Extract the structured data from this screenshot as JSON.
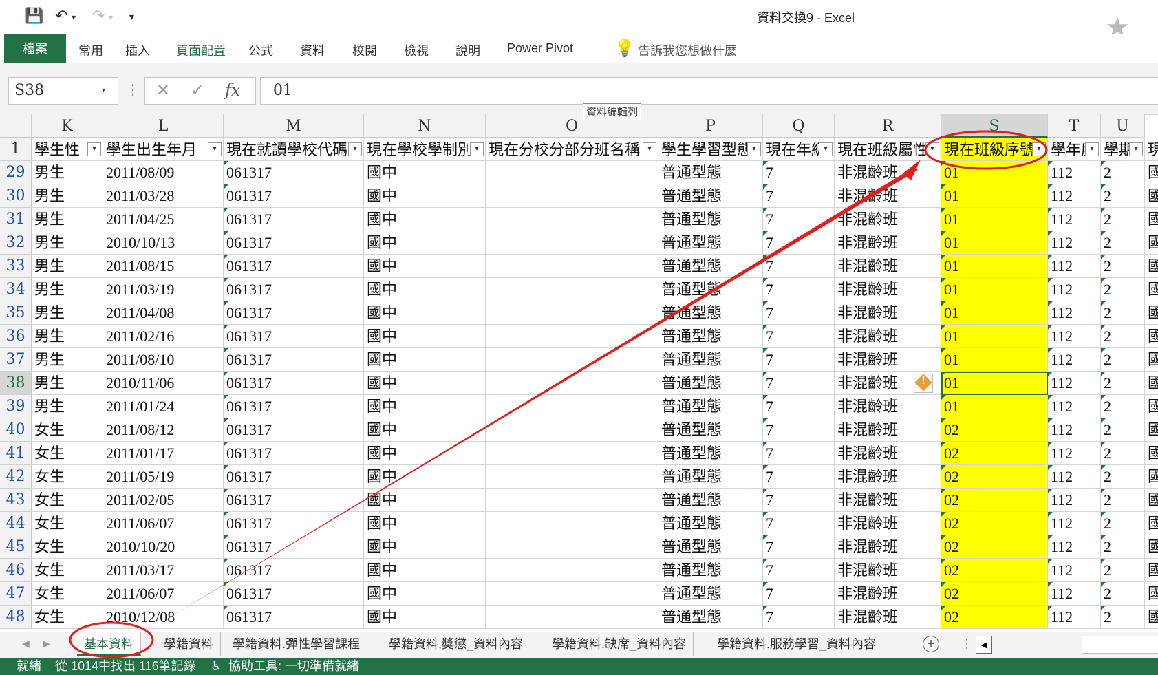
{
  "window": {
    "title": "資料交換9  -  Excel"
  },
  "ribbon": {
    "tabs": [
      "檔案",
      "常用",
      "插入",
      "頁面配置",
      "公式",
      "資料",
      "校閱",
      "檢視",
      "說明",
      "Power Pivot"
    ],
    "tell_me": "告訴我您想做什麼"
  },
  "formula_bar": {
    "name_box": "S38",
    "value": "01",
    "fx": "fx",
    "tooltip": "資料編輯列"
  },
  "columns": [
    "K",
    "L",
    "M",
    "N",
    "O",
    "P",
    "Q",
    "R",
    "S",
    "T",
    "U"
  ],
  "selected_column": "S",
  "header_row": {
    "row_number": "1",
    "cells": [
      "學生性",
      "學生出生年月",
      "現在就讀學校代碼",
      "現在學校學制別",
      "現在分校分部分班名稱",
      "學生學習型態",
      "現在年級",
      "現在班級屬性",
      "現在班級序號",
      "學年度",
      "學期",
      "現"
    ]
  },
  "rows": [
    {
      "n": "29",
      "sex": "男生",
      "dob": "2011/08/09",
      "school": "061317",
      "sys": "國中",
      "branch": "",
      "type": "普通型態",
      "grade": "7",
      "attr": "非混齡班",
      "seq": "01",
      "year": "112",
      "term": "2",
      "v": "國"
    },
    {
      "n": "30",
      "sex": "男生",
      "dob": "2011/03/28",
      "school": "061317",
      "sys": "國中",
      "branch": "",
      "type": "普通型態",
      "grade": "7",
      "attr": "非混齡班",
      "seq": "01",
      "year": "112",
      "term": "2",
      "v": "國"
    },
    {
      "n": "31",
      "sex": "男生",
      "dob": "2011/04/25",
      "school": "061317",
      "sys": "國中",
      "branch": "",
      "type": "普通型態",
      "grade": "7",
      "attr": "非混齡班",
      "seq": "01",
      "year": "112",
      "term": "2",
      "v": "國"
    },
    {
      "n": "32",
      "sex": "男生",
      "dob": "2010/10/13",
      "school": "061317",
      "sys": "國中",
      "branch": "",
      "type": "普通型態",
      "grade": "7",
      "attr": "非混齡班",
      "seq": "01",
      "year": "112",
      "term": "2",
      "v": "國"
    },
    {
      "n": "33",
      "sex": "男生",
      "dob": "2011/08/15",
      "school": "061317",
      "sys": "國中",
      "branch": "",
      "type": "普通型態",
      "grade": "7",
      "attr": "非混齡班",
      "seq": "01",
      "year": "112",
      "term": "2",
      "v": "國"
    },
    {
      "n": "34",
      "sex": "男生",
      "dob": "2011/03/19",
      "school": "061317",
      "sys": "國中",
      "branch": "",
      "type": "普通型態",
      "grade": "7",
      "attr": "非混齡班",
      "seq": "01",
      "year": "112",
      "term": "2",
      "v": "國"
    },
    {
      "n": "35",
      "sex": "男生",
      "dob": "2011/04/08",
      "school": "061317",
      "sys": "國中",
      "branch": "",
      "type": "普通型態",
      "grade": "7",
      "attr": "非混齡班",
      "seq": "01",
      "year": "112",
      "term": "2",
      "v": "國"
    },
    {
      "n": "36",
      "sex": "男生",
      "dob": "2011/02/16",
      "school": "061317",
      "sys": "國中",
      "branch": "",
      "type": "普通型態",
      "grade": "7",
      "attr": "非混齡班",
      "seq": "01",
      "year": "112",
      "term": "2",
      "v": "國"
    },
    {
      "n": "37",
      "sex": "男生",
      "dob": "2011/08/10",
      "school": "061317",
      "sys": "國中",
      "branch": "",
      "type": "普通型態",
      "grade": "7",
      "attr": "非混齡班",
      "seq": "01",
      "year": "112",
      "term": "2",
      "v": "國"
    },
    {
      "n": "38",
      "sex": "男生",
      "dob": "2010/11/06",
      "school": "061317",
      "sys": "國中",
      "branch": "",
      "type": "普通型態",
      "grade": "7",
      "attr": "非混齡班",
      "seq": "01",
      "year": "112",
      "term": "2",
      "v": "國"
    },
    {
      "n": "39",
      "sex": "男生",
      "dob": "2011/01/24",
      "school": "061317",
      "sys": "國中",
      "branch": "",
      "type": "普通型態",
      "grade": "7",
      "attr": "非混齡班",
      "seq": "01",
      "year": "112",
      "term": "2",
      "v": "國"
    },
    {
      "n": "40",
      "sex": "女生",
      "dob": "2011/08/12",
      "school": "061317",
      "sys": "國中",
      "branch": "",
      "type": "普通型態",
      "grade": "7",
      "attr": "非混齡班",
      "seq": "02",
      "year": "112",
      "term": "2",
      "v": "國"
    },
    {
      "n": "41",
      "sex": "女生",
      "dob": "2011/01/17",
      "school": "061317",
      "sys": "國中",
      "branch": "",
      "type": "普通型態",
      "grade": "7",
      "attr": "非混齡班",
      "seq": "02",
      "year": "112",
      "term": "2",
      "v": "國"
    },
    {
      "n": "42",
      "sex": "女生",
      "dob": "2011/05/19",
      "school": "061317",
      "sys": "國中",
      "branch": "",
      "type": "普通型態",
      "grade": "7",
      "attr": "非混齡班",
      "seq": "02",
      "year": "112",
      "term": "2",
      "v": "國"
    },
    {
      "n": "43",
      "sex": "女生",
      "dob": "2011/02/05",
      "school": "061317",
      "sys": "國中",
      "branch": "",
      "type": "普通型態",
      "grade": "7",
      "attr": "非混齡班",
      "seq": "02",
      "year": "112",
      "term": "2",
      "v": "國"
    },
    {
      "n": "44",
      "sex": "女生",
      "dob": "2011/06/07",
      "school": "061317",
      "sys": "國中",
      "branch": "",
      "type": "普通型態",
      "grade": "7",
      "attr": "非混齡班",
      "seq": "02",
      "year": "112",
      "term": "2",
      "v": "國"
    },
    {
      "n": "45",
      "sex": "女生",
      "dob": "2010/10/20",
      "school": "061317",
      "sys": "國中",
      "branch": "",
      "type": "普通型態",
      "grade": "7",
      "attr": "非混齡班",
      "seq": "02",
      "year": "112",
      "term": "2",
      "v": "國"
    },
    {
      "n": "46",
      "sex": "女生",
      "dob": "2011/03/17",
      "school": "061317",
      "sys": "國中",
      "branch": "",
      "type": "普通型態",
      "grade": "7",
      "attr": "非混齡班",
      "seq": "02",
      "year": "112",
      "term": "2",
      "v": "國"
    },
    {
      "n": "47",
      "sex": "女生",
      "dob": "2011/06/07",
      "school": "061317",
      "sys": "國中",
      "branch": "",
      "type": "普通型態",
      "grade": "7",
      "attr": "非混齡班",
      "seq": "02",
      "year": "112",
      "term": "2",
      "v": "國"
    },
    {
      "n": "48",
      "sex": "女生",
      "dob": "2010/12/08",
      "school": "061317",
      "sys": "國中",
      "branch": "",
      "type": "普通型態",
      "grade": "7",
      "attr": "非混齡班",
      "seq": "02",
      "year": "112",
      "term": "2",
      "v": "國"
    }
  ],
  "active_row": "38",
  "sheet_tabs": [
    "基本資料",
    "學籍資料",
    "學籍資料.彈性學習課程",
    "學籍資料.獎懲_資料內容",
    "學籍資料.缺席_資料內容",
    "學籍資料.服務學習_資料內容"
  ],
  "active_sheet": 0,
  "status": {
    "ready": "就緒",
    "filter_result": "從 1014中找出 116筆記錄",
    "accessibility": "協助工具: 一切準備就緒"
  },
  "colors": {
    "excel_green": "#217346",
    "highlight": "#ffff00",
    "annotation_red": "#e0201c"
  }
}
